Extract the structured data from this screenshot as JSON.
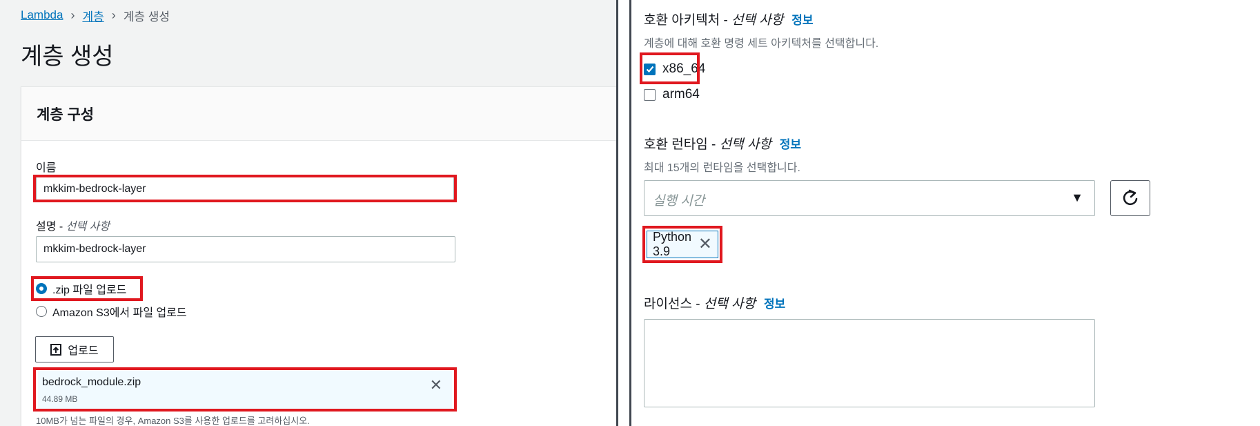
{
  "breadcrumb": {
    "root": "Lambda",
    "layers": "계층",
    "current": "계층 생성"
  },
  "page_title": "계층 생성",
  "layer_config": {
    "title": "계층 구성",
    "name_label": "이름",
    "name_value": "mkkim-bedrock-layer",
    "description_label": "설명 - ",
    "description_optional": "선택 사항",
    "description_value": "mkkim-bedrock-layer",
    "upload_options": [
      {
        "label": ".zip 파일 업로드",
        "checked": true
      },
      {
        "label": "Amazon S3에서 파일 업로드",
        "checked": false
      }
    ],
    "upload_button_label": "업로드",
    "uploaded_file": {
      "name": "bedrock_module.zip",
      "size": "44.89 MB"
    },
    "upload_hint": "10MB가 넘는 파일의 경우, Amazon S3를 사용한 업로드를 고려하십시오."
  },
  "compatible_architectures": {
    "label": "호환 아키텍처 - ",
    "optional": "선택 사항",
    "info": "정보",
    "description": "계층에 대해 호환 명령 세트 아키텍처를 선택합니다.",
    "options": [
      {
        "label": "x86_64",
        "checked": true
      },
      {
        "label": "arm64",
        "checked": false
      }
    ]
  },
  "compatible_runtimes": {
    "label": "호환 런타임 - ",
    "optional": "선택 사항",
    "info": "정보",
    "description": "최대 15개의 런타임을 선택합니다.",
    "placeholder": "실행 시간",
    "selected": [
      "Python 3.9"
    ]
  },
  "license": {
    "label": "라이선스 - ",
    "optional": "선택 사항",
    "info": "정보",
    "value": ""
  },
  "colors": {
    "highlight": "#e0181f",
    "link": "#0073bb",
    "left_background": "#f2f3f3",
    "divider": "#414750"
  },
  "icons": {
    "upload": "upload-arrow-icon",
    "remove": "close-icon",
    "refresh": "refresh-icon",
    "dropdown": "caret-down-icon"
  }
}
